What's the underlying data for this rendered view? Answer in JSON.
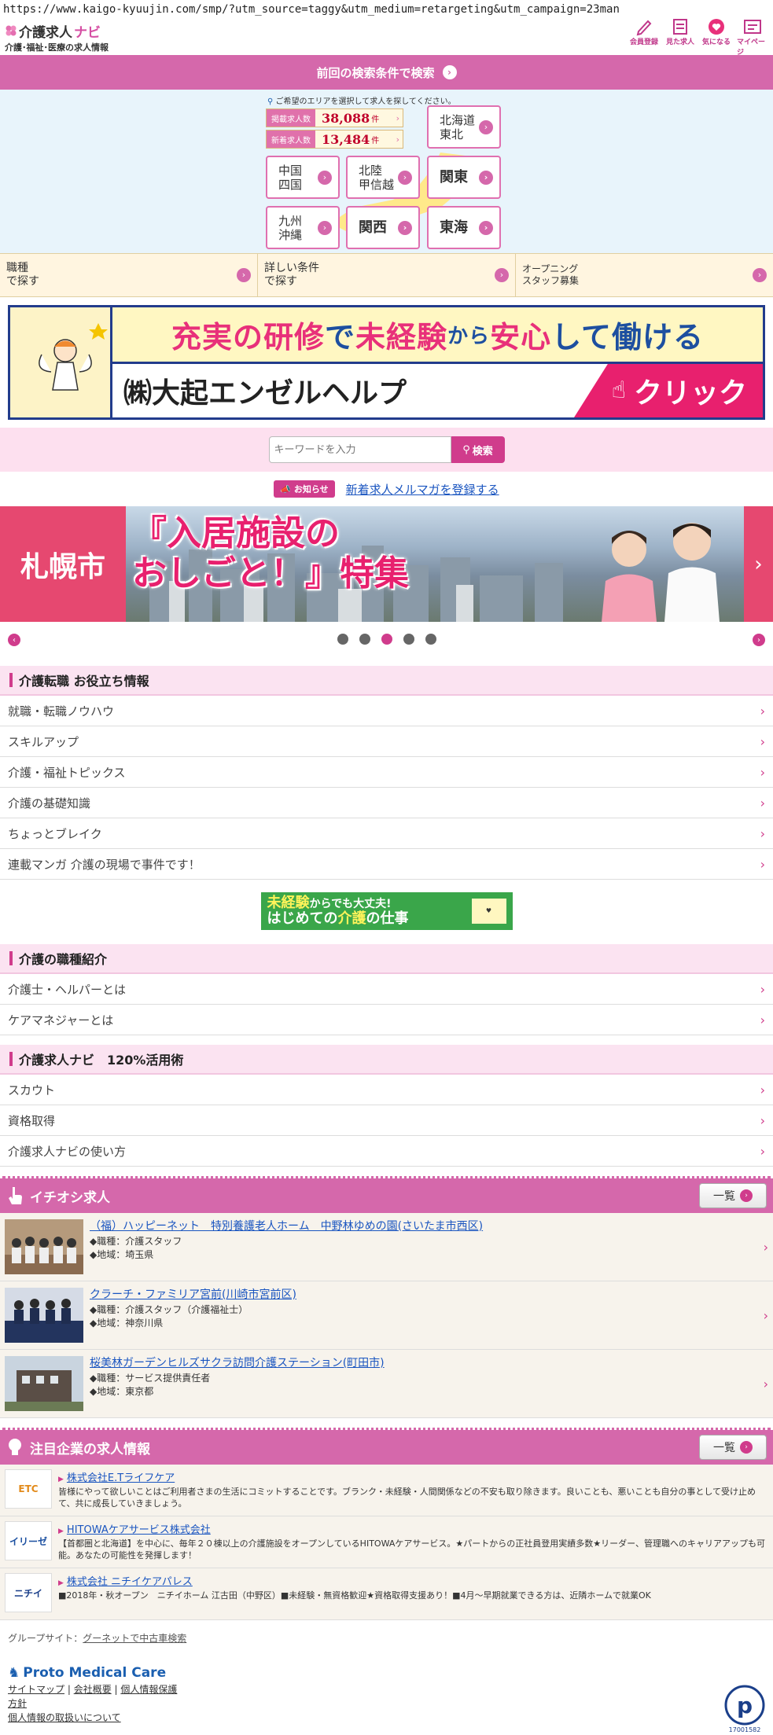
{
  "browser": {
    "url": "https://www.kaigo-kyuujin.com/smp/?utm_source=taggy&utm_medium=retargeting&utm_campaign=23man"
  },
  "header": {
    "logo_main": "介護求人",
    "logo_navi": "ナビ",
    "logo_sub": "介護･福祉･医療の求人情報",
    "icons": [
      {
        "label": "会員登録",
        "icon": "pencil-icon"
      },
      {
        "label": "見た求人",
        "icon": "history-icon"
      },
      {
        "label": "気になる",
        "icon": "heart-icon"
      },
      {
        "label": "マイページ",
        "icon": "mypage-icon"
      }
    ]
  },
  "prev_search": {
    "label": "前回の検索条件で検索"
  },
  "area": {
    "hint": "ご希望のエリアを選択して求人を探してください。",
    "listed_label": "掲載求人数",
    "listed_count": "38,088",
    "new_label": "新着求人数",
    "new_count": "13,484",
    "unit": "件",
    "regions": {
      "hokkaido": [
        "北海道",
        "東北"
      ],
      "chugoku": [
        "中国",
        "四国"
      ],
      "hokuriku": [
        "北陸",
        "甲信越"
      ],
      "kanto": "関東",
      "kyushu": [
        "九州",
        "沖縄"
      ],
      "kansai": "関西",
      "tokai": "東海"
    }
  },
  "search_tabs": [
    {
      "line1": "職種",
      "line2": "で探す"
    },
    {
      "line1": "詳しい条件",
      "line2": "で探す"
    },
    {
      "line1": "オープニング",
      "line2": "スタッフ募集"
    }
  ],
  "banner1": {
    "line1_a": "充実の研修",
    "line1_b": "で",
    "line1_c": "未経験",
    "line1_d": "から",
    "line1_e": "安心",
    "line1_f": "して働ける",
    "company": "㈱大起エンゼルヘルプ",
    "click": "クリック"
  },
  "keyword": {
    "placeholder": "キーワードを入力",
    "button": "検索"
  },
  "notice": {
    "badge": "お知らせ",
    "link": "新着求人メルマガを登録する"
  },
  "banner2": {
    "city": "札幌市",
    "title_line1": "『入居施設の",
    "title_line2": "おしごと！』特集"
  },
  "slider": {
    "count": 5,
    "active_index": 2
  },
  "sections": {
    "tips": {
      "title": "介護転職 お役立ち情報",
      "items": [
        "就職・転職ノウハウ",
        "スキルアップ",
        "介護・福祉トピックス",
        "介護の基礎知識",
        "ちょっとブレイク",
        "連載マンガ 介護の現場で事件です！"
      ]
    },
    "mini_banner": {
      "line1_a": "未経験",
      "line1_b": "からでも大丈夫!",
      "line2_a": "はじめての",
      "line2_b": "介護",
      "line2_c": "の仕事"
    },
    "jobtypes": {
      "title": "介護の職種紹介",
      "items": [
        "介護士・ヘルパーとは",
        "ケアマネジャーとは"
      ]
    },
    "usage": {
      "title": "介護求人ナビ　120%活用術",
      "items": [
        "スカウト",
        "資格取得",
        "介護求人ナビの使い方"
      ]
    }
  },
  "pickup": {
    "title": "イチオシ求人",
    "all_label": "一覧",
    "jobs": [
      {
        "title": "（福）ハッピーネット　特別養護老人ホーム　中野林ゆめの園(さいたま市西区)",
        "role": "◆職種：介護スタッフ",
        "area": "◆地域：埼玉県"
      },
      {
        "title": "クラーチ・ファミリア宮前(川崎市宮前区)",
        "role": "◆職種：介護スタッフ（介護福祉士）",
        "area": "◆地域：神奈川県"
      },
      {
        "title": "桜美林ガーデンヒルズサクラ訪問介護ステーション(町田市)",
        "role": "◆職種：サービス提供責任者",
        "area": "◆地域：東京都"
      }
    ]
  },
  "featured": {
    "title": "注目企業の求人情報",
    "all_label": "一覧",
    "companies": [
      {
        "logo": "ETC",
        "name": "株式会社E.Tライフケア",
        "desc": "皆様にやって欲しいことはご利用者さまの生活にコミットすることです。ブランク・未経験・人間関係などの不安も取り除きます。良いことも、悪いことも自分の事として受け止めて、共に成長していきましょう。"
      },
      {
        "logo": "イリーゼ",
        "name": "HITOWAケアサービス株式会社",
        "desc": "【首都圏と北海道】を中心に、毎年２０棟以上の介護施設をオープンしているHITOWAケアサービス。★パートからの正社員登用実績多数★リーダー、管理職へのキャリアアップも可能。あなたの可能性を発揮します！"
      },
      {
        "logo": "ニチイ",
        "name": "株式会社 ニチイケアパレス",
        "desc": "■2018年・秋オープン　ニチイホーム 江古田（中野区）■未経験・無資格歓迎★資格取得支援あり！■4月～早期就業できる方は、近隣ホームで就業OK"
      }
    ]
  },
  "footer": {
    "group_label": "グループサイト：",
    "group_link": "グーネットで中古車検索",
    "brand": "Proto Medical Care",
    "links_row1": [
      "サイトマップ",
      "会社概要",
      "個人情報保護"
    ],
    "links_row2": "方針",
    "links_row3": "個人情報の取扱いについて",
    "pmark_number": "17001582"
  },
  "colors": {
    "accent": "#d568ab",
    "link": "#1a55c0",
    "price": "#c0002b"
  }
}
